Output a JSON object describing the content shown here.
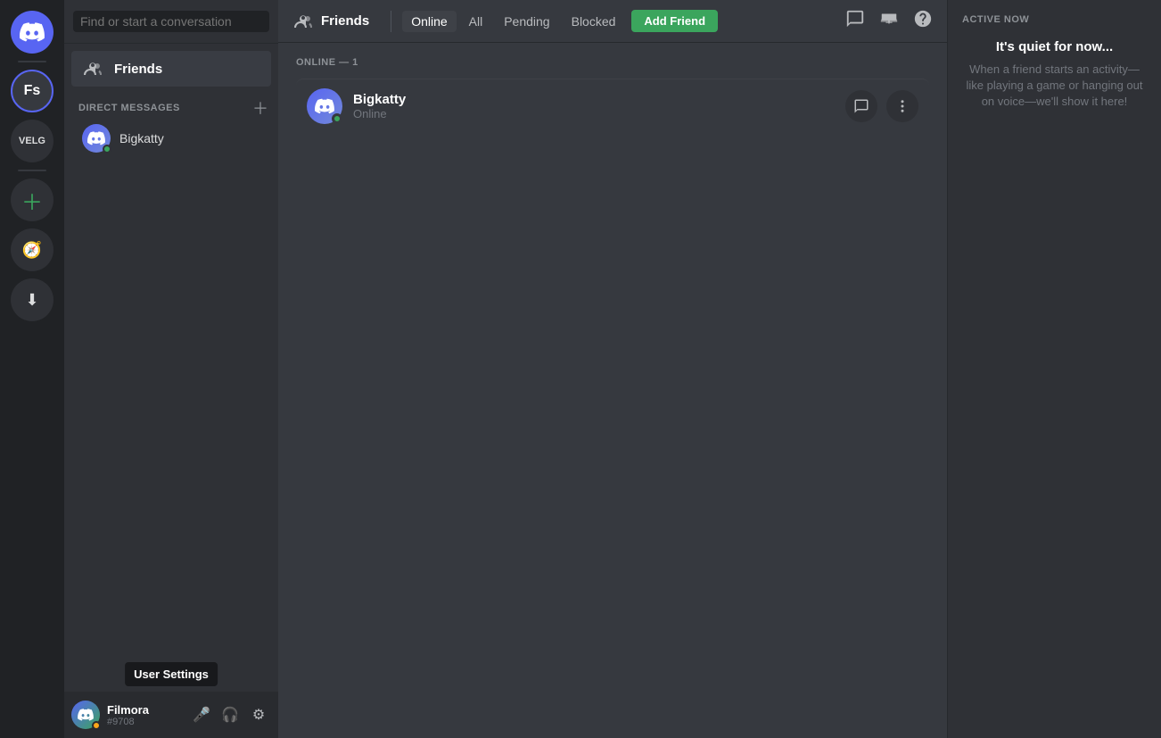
{
  "app": {
    "title": "Discord"
  },
  "server_sidebar": {
    "items": [
      {
        "id": "home",
        "label": "Home",
        "icon": "discord-home",
        "type": "discord"
      },
      {
        "id": "fs",
        "label": "Fs",
        "icon": "fs",
        "type": "server"
      },
      {
        "id": "velg",
        "label": "VELG",
        "icon": "velg",
        "type": "server"
      },
      {
        "id": "add",
        "label": "Add a Server",
        "icon": "add",
        "type": "action"
      },
      {
        "id": "explore",
        "label": "Explore Public Servers",
        "icon": "explore",
        "type": "action"
      },
      {
        "id": "download",
        "label": "Download Apps",
        "icon": "download",
        "type": "action"
      }
    ]
  },
  "dm_sidebar": {
    "search_placeholder": "Find or start a conversation",
    "friends_label": "Friends",
    "direct_messages_label": "DIRECT MESSAGES",
    "add_dm_label": "+",
    "dm_users": [
      {
        "id": "bigkatty",
        "name": "Bigkatty",
        "status": "online"
      }
    ]
  },
  "user_area": {
    "username": "Filmora",
    "discriminator": "#9708",
    "status": "idle",
    "tooltip": "User Settings",
    "controls": {
      "mute_label": "🎤",
      "deafen_label": "🎧",
      "settings_label": "⚙"
    }
  },
  "top_bar": {
    "friends_label": "Friends",
    "tabs": [
      {
        "id": "online",
        "label": "Online",
        "active": true
      },
      {
        "id": "all",
        "label": "All",
        "active": false
      },
      {
        "id": "pending",
        "label": "Pending",
        "active": false
      },
      {
        "id": "blocked",
        "label": "Blocked",
        "active": false
      }
    ],
    "add_friend_label": "Add Friend",
    "icons": {
      "new_group": "💬",
      "inbox": "📥",
      "help": "❓"
    }
  },
  "friends_list": {
    "online_count_label": "ONLINE — 1",
    "friends": [
      {
        "id": "bigkatty",
        "name": "Bigkatty",
        "status": "Online",
        "avatar_color": "#5865f2"
      }
    ]
  },
  "active_now": {
    "title": "ACTIVE NOW",
    "quiet_title": "It's quiet for now...",
    "quiet_desc": "When a friend starts an activity—like playing a game or hanging out on voice—we'll show it here!"
  }
}
